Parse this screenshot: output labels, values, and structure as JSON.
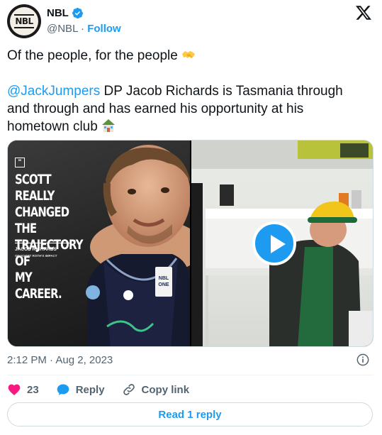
{
  "author": {
    "display_name": "NBL",
    "handle": "@NBL",
    "separator": " · ",
    "follow_label": "Follow",
    "avatar_text": "NBL"
  },
  "tweet": {
    "line1": "Of the people, for the people",
    "mention": "@JackJumpers",
    "body": " DP Jacob Richards is Tasmania through and through and has earned his opportunity at his hometown club",
    "emoji1": "handshake-emoji",
    "emoji2": "house-emoji"
  },
  "media": {
    "left": {
      "quote_mark": "“",
      "headline": "SCOTT REALLY\nCHANGED THE\nTRAJECTORY OF\nMY CAREER.",
      "caption_name": "JACOB RICHARDS",
      "caption_sub": "ON SCOTT ROTH'S IMPACT",
      "jersey_badge_top": "NBL",
      "jersey_badge_bottom": "ONE"
    },
    "right": {
      "play_icon": "play-icon"
    }
  },
  "meta": {
    "timestamp": "2:12 PM · Aug 2, 2023"
  },
  "actions": {
    "likes_count": "23",
    "reply_label": "Reply",
    "copy_link_label": "Copy link"
  },
  "read_replies_label": "Read 1 reply",
  "colors": {
    "accent": "#1d9bf0",
    "like": "#f91880",
    "secondary_text": "#536471"
  }
}
